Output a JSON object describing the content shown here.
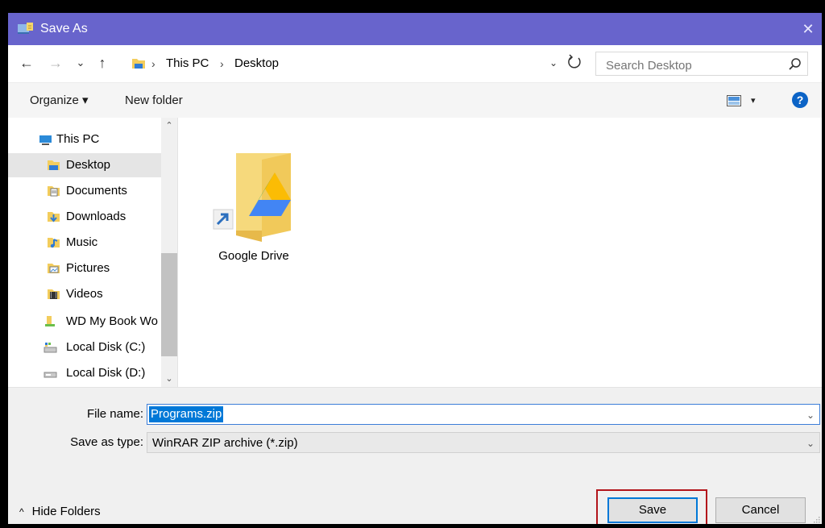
{
  "window": {
    "title": "Save As",
    "close_glyph": "✕"
  },
  "address": {
    "back_glyph": "←",
    "forward_glyph": "→",
    "recent_glyph": "⌄",
    "up_glyph": "↑",
    "crumbs": [
      "This PC",
      "Desktop"
    ],
    "separator_glyph": "›",
    "dropdown_glyph": "⌄"
  },
  "search": {
    "placeholder": "Search Desktop"
  },
  "toolbar": {
    "organize_label": "Organize ▾",
    "new_folder_label": "New folder",
    "view_drop_glyph": "▾",
    "help_label": "?"
  },
  "nav": {
    "scroll_up_glyph": "⌃",
    "scroll_down_glyph": "⌄",
    "items": [
      {
        "label": "This PC",
        "icon": "pc-icon"
      },
      {
        "label": "Desktop",
        "icon": "desktop-folder-icon",
        "selected": true
      },
      {
        "label": "Documents",
        "icon": "documents-icon"
      },
      {
        "label": "Downloads",
        "icon": "downloads-icon"
      },
      {
        "label": "Music",
        "icon": "music-icon"
      },
      {
        "label": "Pictures",
        "icon": "pictures-icon"
      },
      {
        "label": "Videos",
        "icon": "videos-icon"
      },
      {
        "label": "WD My Book Wo",
        "icon": "usb-drive-icon"
      },
      {
        "label": "Local Disk (C:)",
        "icon": "local-disk-icon"
      },
      {
        "label": "Local Disk (D:)",
        "icon": "local-disk-icon"
      }
    ]
  },
  "content": {
    "items": [
      {
        "label": "Google Drive",
        "icon": "google-drive-folder-icon"
      }
    ]
  },
  "form": {
    "file_name_label": "File name:",
    "file_name_value": "Programs.zip",
    "save_type_label": "Save as type:",
    "save_type_value": "WinRAR ZIP archive (*.zip)",
    "dropdown_glyph": "⌄"
  },
  "footer": {
    "hide_folders_label": "Hide Folders",
    "hide_folders_glyph": "^",
    "save_label": "Save",
    "cancel_label": "Cancel"
  },
  "colors": {
    "titlebar": "#6864cc",
    "selection": "#0078d7",
    "highlight_border": "#b3151b"
  }
}
